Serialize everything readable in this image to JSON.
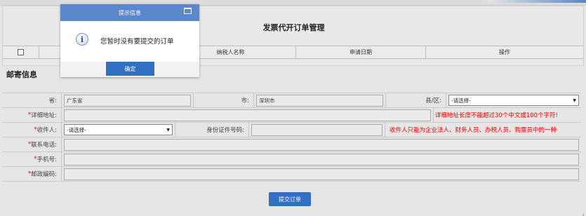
{
  "page": {
    "title": "发票代开订单管理"
  },
  "table": {
    "columns": [
      "",
      "",
      "纳税人名称",
      "申请日期",
      "操作"
    ]
  },
  "mail_section": {
    "title": "邮寄信息",
    "province_label": "省:",
    "province_value": "广东省",
    "city_label": "市:",
    "city_value": "深圳市",
    "county_label": "县/区:",
    "county_value": "-请选择-",
    "address_label": "详细地址:",
    "address_value": "",
    "address_warning": "详细地址长度不能超过30个中文或100个字符!",
    "recipient_label": "收件人:",
    "recipient_value": "-请选择-",
    "id_label": "身份证件号码:",
    "id_value": "",
    "recipient_warning": "收件人只能为企业法人、财务人员、办税人员、购票员中的一种",
    "phone_label": "联系电话:",
    "mobile_label": "手机号:",
    "postal_label": "邮政编码:",
    "required_mark": "*"
  },
  "submit_label": "提交订单",
  "dialog": {
    "title": "提示信息",
    "message": "您暂时没有要提交的订单",
    "ok_label": "确定",
    "icon": "info-icon"
  },
  "colors": {
    "accent": "#2f6fc4",
    "dialog_header": "#5b87cc",
    "warning": "#ee0000"
  }
}
